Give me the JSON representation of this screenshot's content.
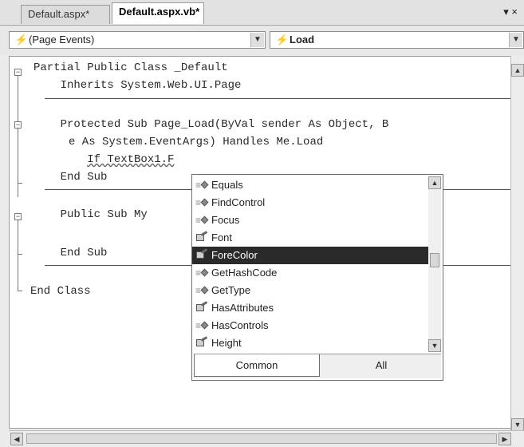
{
  "tabs": {
    "tab1": "Default.aspx*",
    "tab2": "Default.aspx.vb*",
    "dropdown_glyph": "▾",
    "close_glyph": "×"
  },
  "combos": {
    "left_value": "(Page Events)",
    "right_value": "Load"
  },
  "code": {
    "line1": "Partial Public Class _Default",
    "line2": "    Inherits System.Web.UI.Page",
    "line3": "    Protected Sub Page_Load(ByVal sender As Object, B",
    "line4": "e As System.EventArgs) Handles Me.Load",
    "line5_prefix": "        ",
    "line5_typed": "If TextBox1.F",
    "line6": "    End Sub",
    "line7": "    Public Sub My",
    "line8": "    End Sub",
    "line9": "End Class"
  },
  "intellisense": {
    "items": [
      {
        "label": "Equals",
        "icon": "method"
      },
      {
        "label": "FindControl",
        "icon": "method"
      },
      {
        "label": "Focus",
        "icon": "method"
      },
      {
        "label": "Font",
        "icon": "property"
      },
      {
        "label": "ForeColor",
        "icon": "property",
        "selected": true
      },
      {
        "label": "GetHashCode",
        "icon": "method"
      },
      {
        "label": "GetType",
        "icon": "method"
      },
      {
        "label": "HasAttributes",
        "icon": "property"
      },
      {
        "label": "HasControls",
        "icon": "method"
      },
      {
        "label": "Height",
        "icon": "property"
      }
    ],
    "tab_common": "Common",
    "tab_all": "All"
  },
  "colors": {
    "selection": "#2a2a2a",
    "editor_bg": "#ffffff"
  }
}
